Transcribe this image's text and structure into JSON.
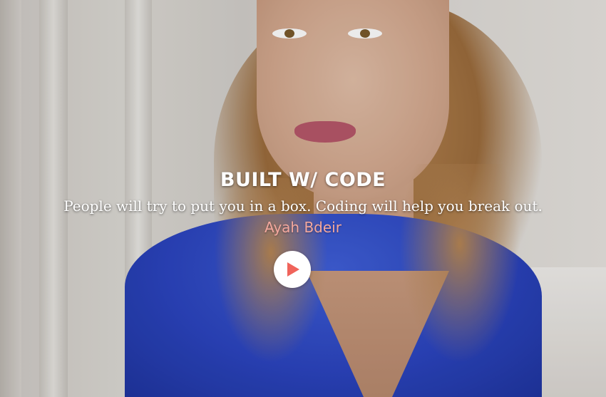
{
  "hero": {
    "heading": "BUILT W/ CODE",
    "quote": "People will try to put you in a box. Coding will help you break out.",
    "author": "Ayah Bdeir"
  },
  "play_button": {
    "icon": "play-icon",
    "icon_color": "#f0645b"
  },
  "colors": {
    "author": "#f4a89e",
    "shirt": "#2c45c0"
  }
}
